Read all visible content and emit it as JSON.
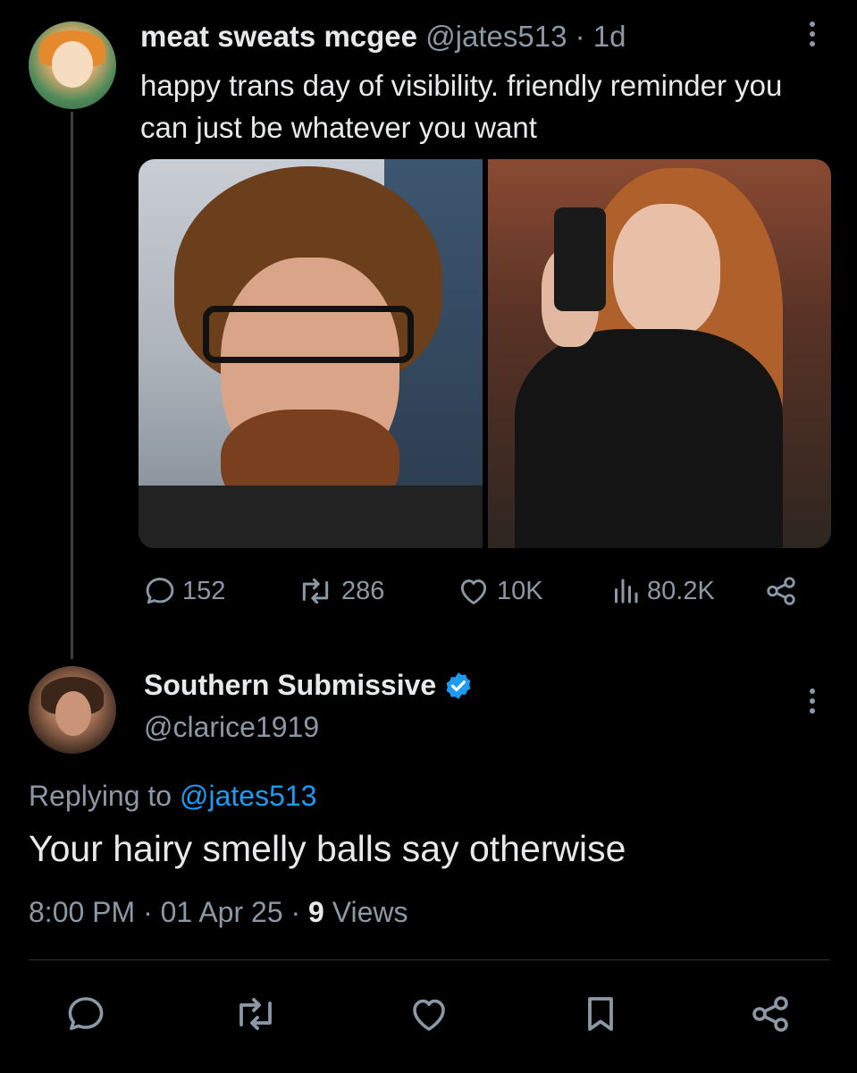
{
  "tweet": {
    "author_name": "meat sweats mcgee",
    "author_handle": "@jates513",
    "separator": "·",
    "age": "1d",
    "text": "happy trans day of visibility. friendly reminder you can just be whatever you want",
    "stats": {
      "replies": "152",
      "reposts": "286",
      "likes": "10K",
      "views": "80.2K"
    }
  },
  "reply": {
    "author_name": "Southern Submissive",
    "author_handle": "@clarice1919",
    "verified": true,
    "replying_to_label": "Replying to",
    "replying_to_handle": "@jates513",
    "text": "Your hairy smelly balls say otherwise",
    "time": "8:00 PM",
    "separator": "·",
    "date": "01 Apr 25",
    "views_count": "9",
    "views_label": "Views"
  },
  "colors": {
    "background": "#000000",
    "text": "#e7e9ea",
    "muted": "#8b98a5",
    "accent": "#1d9bf0"
  },
  "icons": {
    "reply": "reply-icon",
    "repost": "repost-icon",
    "like": "heart-icon",
    "views": "views-icon",
    "share": "share-icon",
    "bookmark": "bookmark-icon",
    "more": "more-icon",
    "verified": "verified-badge-icon"
  }
}
